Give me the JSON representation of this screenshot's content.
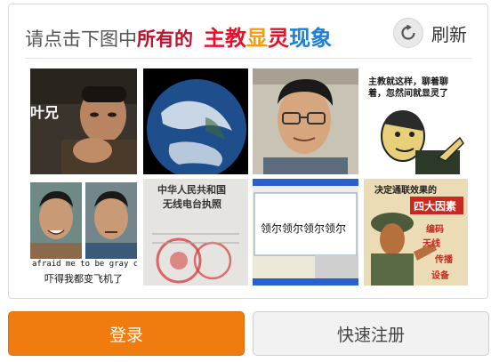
{
  "prompt": {
    "part1": "请点击下图中",
    "keyword": "所有的",
    "w1": "主",
    "w2": "教",
    "w3": "显",
    "w4": "灵",
    "w5": "现象"
  },
  "refresh_label": "刷新",
  "tiles": {
    "t1_caption": "叶兄",
    "t4_caption_line1": "主教就这样，聊着聊",
    "t4_caption_line2": "着，忽然间就显灵了",
    "t5_caption_en": "afraid me to be gray chick",
    "t5_caption_cn": "吓得我都变飞机了",
    "t6_line1": "中华人民共和国",
    "t6_line2": "无线电台执照",
    "t7_text": "领尔领尔领尔领尔",
    "t8_title": "决定通联效果的",
    "t8_banner": "四大因素",
    "t8_w1": "编码",
    "t8_w2": "天线",
    "t8_w3": "传播",
    "t8_w4": "设备"
  },
  "buttons": {
    "login": "登录",
    "register": "快速注册"
  },
  "colors": {
    "login_bg": "#f07c0f",
    "register_bg": "#f2f2f2",
    "prompt_red": "#e8102a",
    "prompt_orange": "#f39c12",
    "prompt_blue": "#1e7fd6"
  }
}
